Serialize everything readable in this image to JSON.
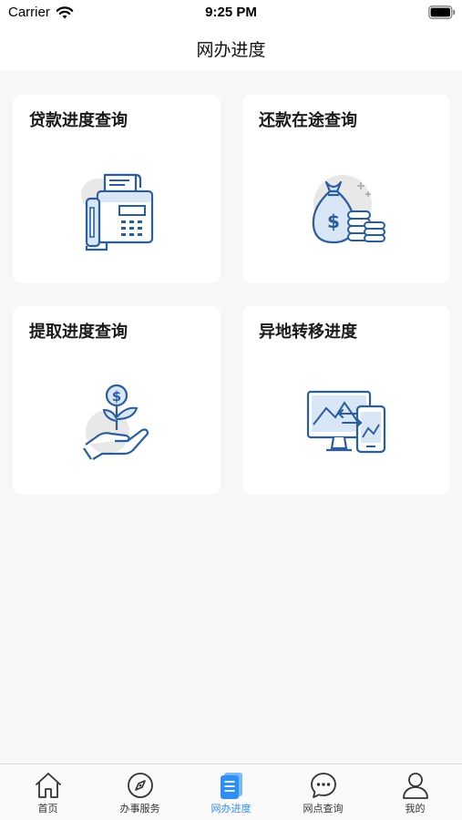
{
  "status_bar": {
    "carrier": "Carrier",
    "time": "9:25 PM"
  },
  "nav": {
    "title": "网办进度"
  },
  "cards": [
    {
      "label": "贷款进度查询",
      "icon": "fax-machine-icon"
    },
    {
      "label": "还款在途查询",
      "icon": "money-bag-coins-icon"
    },
    {
      "label": "提取进度查询",
      "icon": "hand-coin-plant-icon"
    },
    {
      "label": "异地转移进度",
      "icon": "monitor-phone-transfer-icon"
    }
  ],
  "tabs": [
    {
      "label": "首页",
      "icon": "home-icon",
      "active": false
    },
    {
      "label": "办事服务",
      "icon": "compass-icon",
      "active": false
    },
    {
      "label": "网办进度",
      "icon": "document-icon",
      "active": true
    },
    {
      "label": "网点查询",
      "icon": "chat-bubble-icon",
      "active": false
    },
    {
      "label": "我的",
      "icon": "user-icon",
      "active": false
    }
  ],
  "colors": {
    "accent": "#2f8ef5",
    "icon_stroke": "#2a5d9e",
    "icon_fill": "#d8e6f5",
    "background": "#f7f7f7"
  }
}
